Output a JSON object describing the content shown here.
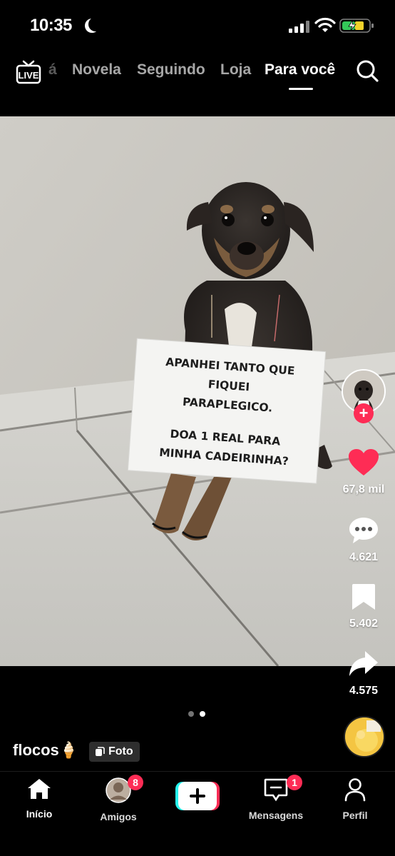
{
  "status_bar": {
    "time": "10:35"
  },
  "top_nav": {
    "live_label": "LIVE",
    "tabs": [
      {
        "label": "á"
      },
      {
        "label": "Novela"
      },
      {
        "label": "Seguindo"
      },
      {
        "label": "Loja"
      },
      {
        "label": "Para você"
      }
    ],
    "active_tab": "Para você"
  },
  "post": {
    "sign_lines": [
      "APANHEI TANTO QUE",
      "FIQUEI",
      "PARAPLEGICO.",
      "DOA 1 REAL PARA",
      "MINHA CADEIRINHA?"
    ],
    "username": "flocos🍦",
    "type_label": "Foto",
    "image_count": 2,
    "active_image": 2
  },
  "actions": {
    "likes": "67,8 mil",
    "comments": "4.621",
    "saves": "5.402",
    "shares": "4.575"
  },
  "bottom_nav": {
    "items": [
      {
        "label": "Início"
      },
      {
        "label": "Amigos",
        "badge": "8"
      },
      {
        "label": ""
      },
      {
        "label": "Mensagens",
        "badge": "1"
      },
      {
        "label": "Perfil"
      }
    ]
  },
  "colors": {
    "accent": "#fe2c55",
    "background": "#000000"
  },
  "icons": [
    "live-icon",
    "search-icon",
    "heart-icon",
    "comment-icon",
    "bookmark-icon",
    "share-icon",
    "home-icon",
    "inbox-icon",
    "profile-icon",
    "plus-icon"
  ]
}
